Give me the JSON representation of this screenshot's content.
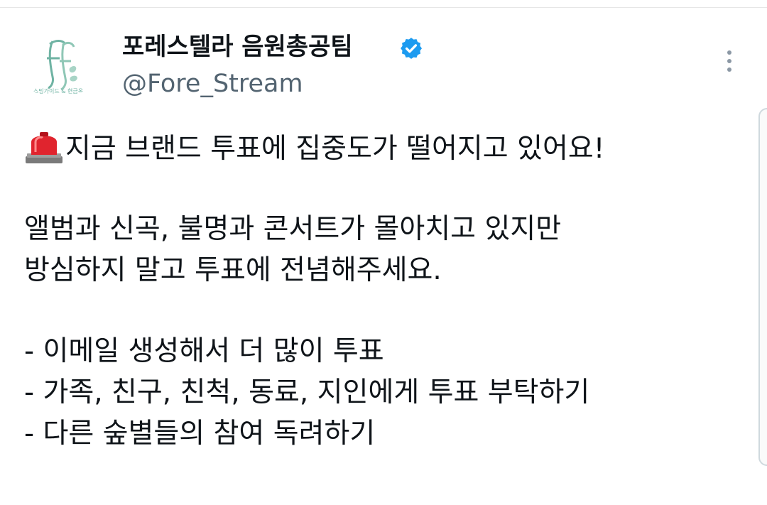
{
  "account": {
    "display_name": "포레스텔라 음원총공팀",
    "handle": "@Fore_Stream",
    "avatar_caption": "스밍가이드 & 현금옥"
  },
  "colors": {
    "verified": "#1d9bf0",
    "text": "#0f1419",
    "handle": "#536471",
    "avatar_accent": "#6fb3a3"
  },
  "icons": {
    "siren": "rotating-light-emoji",
    "verified": "verified-badge-icon",
    "more": "more-vertical-icon"
  },
  "tweet": {
    "line1": "지금 브랜드 투표에 집중도가 떨어지고 있어요!",
    "line2": "앨범과 신곡, 불명과 콘서트가 몰아치고 있지만",
    "line3": "방심하지 말고 투표에 전념해주세요.",
    "bullet1": "- 이메일 생성해서 더 많이 투표",
    "bullet2": "- 가족, 친구, 친척, 동료, 지인에게 투표 부탁하기",
    "bullet3": "- 다른 숲별들의 참여 독려하기"
  }
}
